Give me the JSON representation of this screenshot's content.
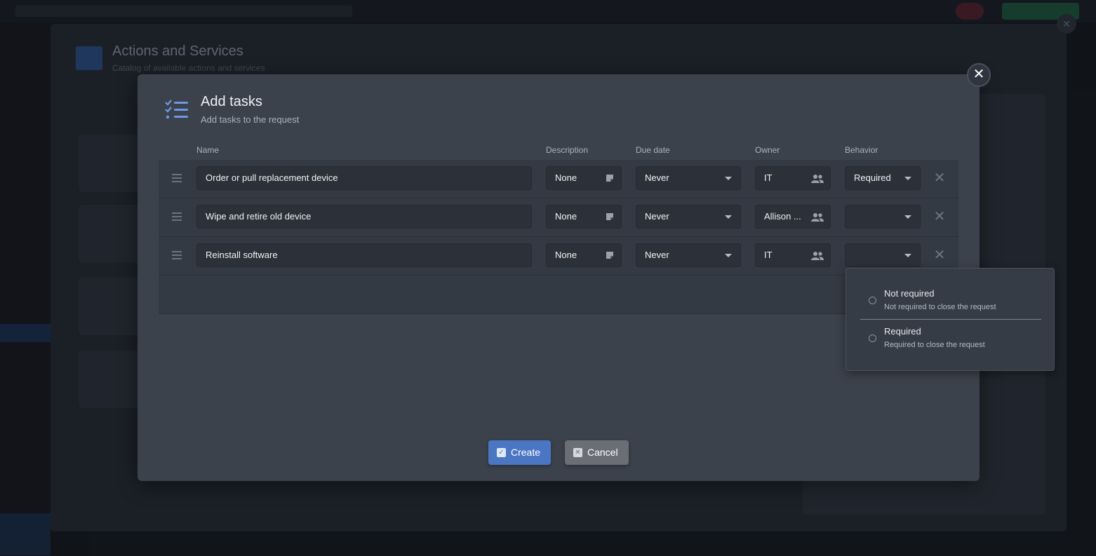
{
  "background": {
    "title": "Actions and Services",
    "subtitle": "Catalog of available actions and services"
  },
  "modal": {
    "title": "Add tasks",
    "subtitle": "Add tasks to the request",
    "close_symbol": "✕"
  },
  "columns": {
    "name": "Name",
    "description": "Description",
    "due_date": "Due date",
    "owner": "Owner",
    "behavior": "Behavior"
  },
  "rows": [
    {
      "name": "Order or pull replacement device",
      "description": "None",
      "due_date": "Never",
      "owner": "IT",
      "behavior": "Required"
    },
    {
      "name": "Wipe and retire old device",
      "description": "None",
      "due_date": "Never",
      "owner": "Allison ...",
      "behavior": ""
    },
    {
      "name": "Reinstall software",
      "description": "None",
      "due_date": "Never",
      "owner": "IT",
      "behavior": ""
    }
  ],
  "behavior_dropdown": {
    "options": [
      {
        "label": "Not required",
        "description": "Not required to close the request",
        "selected": false
      },
      {
        "label": "Required",
        "description": "Required to close the request",
        "selected": false
      }
    ]
  },
  "buttons": {
    "create": "Create",
    "cancel": "Cancel"
  },
  "icons": {
    "modal": "task-list-icon",
    "row_handle": "drag-handle-icon",
    "description": "note-icon",
    "owner": "people-icon",
    "remove": "close-icon"
  },
  "colors": {
    "modal_bg": "#3c424c",
    "accent": "#4b76c4",
    "cancel": "#6b6f75",
    "field_bg": "#2c3139"
  }
}
